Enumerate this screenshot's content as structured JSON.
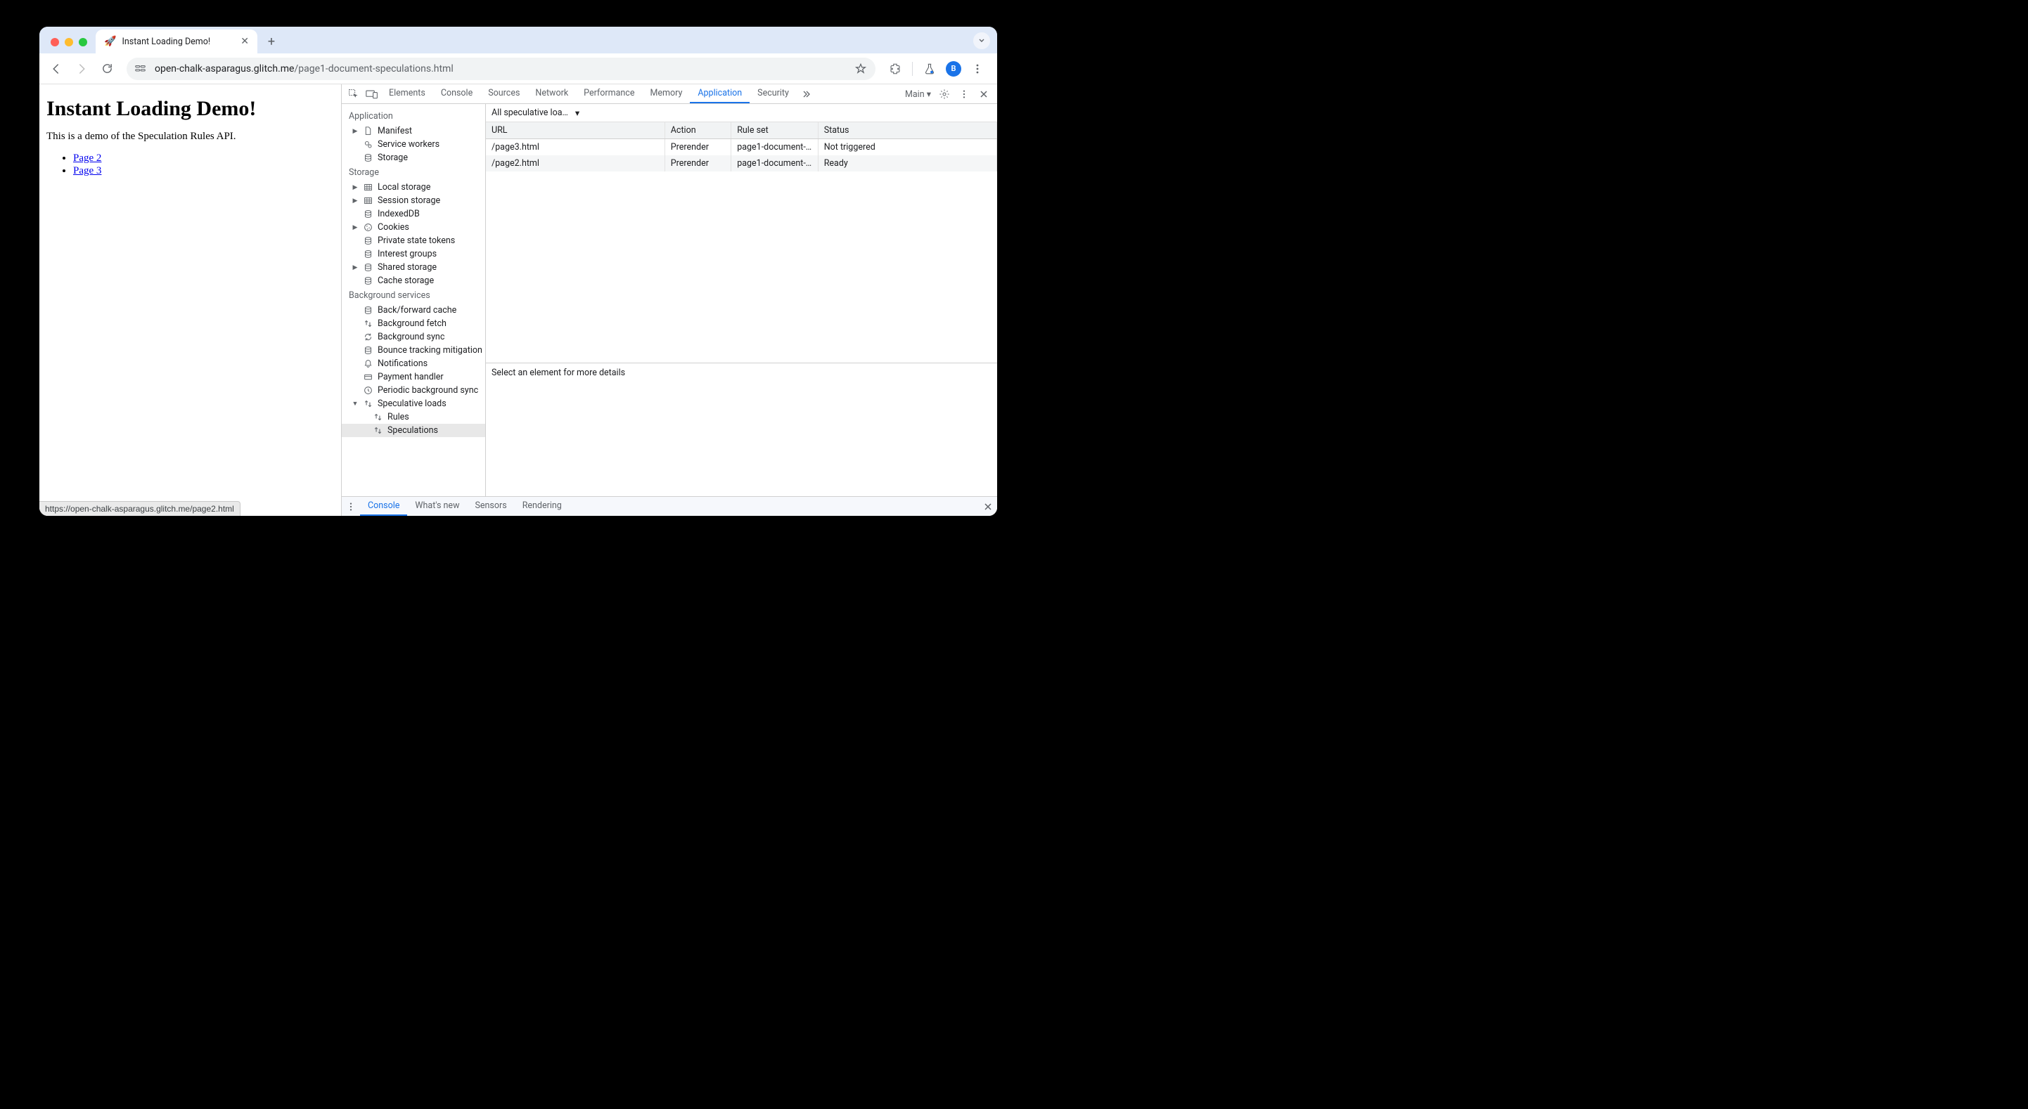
{
  "browser": {
    "tab": {
      "favicon": "🚀",
      "title": "Instant Loading Demo!"
    },
    "url_host": "open-chalk-asparagus.glitch.me",
    "url_path": "/page1-document-speculations.html",
    "avatar_letter": "B",
    "status_bar": "https://open-chalk-asparagus.glitch.me/page2.html"
  },
  "page": {
    "heading": "Instant Loading Demo!",
    "paragraph": "This is a demo of the Speculation Rules API.",
    "links": [
      "Page 2",
      "Page 3"
    ]
  },
  "devtools": {
    "tabs": [
      "Elements",
      "Console",
      "Sources",
      "Network",
      "Performance",
      "Memory",
      "Application",
      "Security"
    ],
    "active_tab": "Application",
    "main_label": "Main",
    "filter_label": "All speculative loa…",
    "detail_hint": "Select an element for more details",
    "drawer_tabs": [
      "Console",
      "What's new",
      "Sensors",
      "Rendering"
    ],
    "drawer_active": "Console",
    "sidebar": {
      "sections": [
        {
          "title": "Application",
          "items": [
            {
              "label": "Manifest",
              "icon": "file",
              "tri": "▶"
            },
            {
              "label": "Service workers",
              "icon": "gears"
            },
            {
              "label": "Storage",
              "icon": "db"
            }
          ]
        },
        {
          "title": "Storage",
          "items": [
            {
              "label": "Local storage",
              "icon": "grid",
              "tri": "▶"
            },
            {
              "label": "Session storage",
              "icon": "grid",
              "tri": "▶"
            },
            {
              "label": "IndexedDB",
              "icon": "db"
            },
            {
              "label": "Cookies",
              "icon": "cookie",
              "tri": "▶"
            },
            {
              "label": "Private state tokens",
              "icon": "db"
            },
            {
              "label": "Interest groups",
              "icon": "db"
            },
            {
              "label": "Shared storage",
              "icon": "db",
              "tri": "▶"
            },
            {
              "label": "Cache storage",
              "icon": "db"
            }
          ]
        },
        {
          "title": "Background services",
          "items": [
            {
              "label": "Back/forward cache",
              "icon": "db"
            },
            {
              "label": "Background fetch",
              "icon": "updown"
            },
            {
              "label": "Background sync",
              "icon": "sync"
            },
            {
              "label": "Bounce tracking mitigation",
              "icon": "db"
            },
            {
              "label": "Notifications",
              "icon": "bell"
            },
            {
              "label": "Payment handler",
              "icon": "card"
            },
            {
              "label": "Periodic background sync",
              "icon": "clock"
            },
            {
              "label": "Speculative loads",
              "icon": "updown",
              "tri": "▼",
              "expanded": true,
              "children": [
                {
                  "label": "Rules",
                  "icon": "updown"
                },
                {
                  "label": "Speculations",
                  "icon": "updown",
                  "selected": true
                }
              ]
            }
          ]
        }
      ]
    },
    "table": {
      "columns": [
        "URL",
        "Action",
        "Rule set",
        "Status"
      ],
      "rows": [
        {
          "url": "/page3.html",
          "action": "Prerender",
          "ruleset": "page1-document-…",
          "status": "Not triggered"
        },
        {
          "url": "/page2.html",
          "action": "Prerender",
          "ruleset": "page1-document-…",
          "status": "Ready"
        }
      ]
    }
  }
}
